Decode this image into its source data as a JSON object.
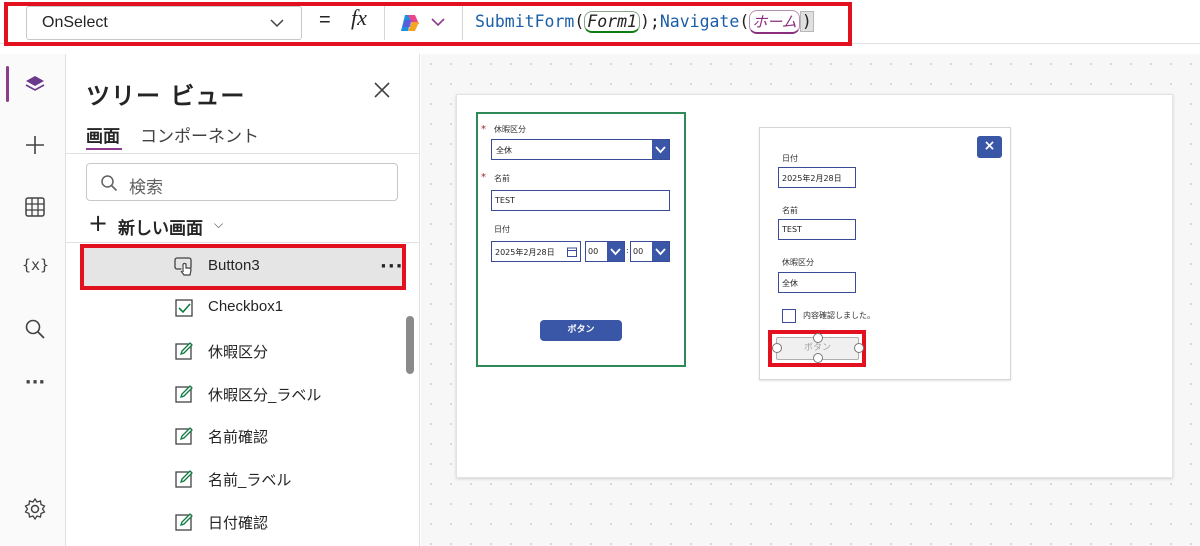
{
  "formula_bar": {
    "property": "OnSelect",
    "equals": "=",
    "fx": "fx",
    "formula": {
      "fn1": "SubmitForm",
      "open1": "(",
      "arg1": "Form1",
      "close1": ")",
      "sep": ";",
      "fn2": "Navigate",
      "open2": "(",
      "arg2": "ホーム",
      "close2": ")"
    }
  },
  "rail": {
    "icons": [
      "layers-icon",
      "plus-icon",
      "data-table-icon",
      "variables-icon",
      "search-icon",
      "more-icon",
      "settings-icon"
    ],
    "variables_label": "{x}",
    "more_label": "···"
  },
  "tree": {
    "title": "ツリー ビュー",
    "tabs": [
      {
        "label": "画面"
      },
      {
        "label": "コンポーネント"
      }
    ],
    "search_placeholder": "検索",
    "new_screen_label": "新しい画面",
    "items": [
      {
        "label": "Button3",
        "icon": "button-icon"
      },
      {
        "label": "Checkbox1",
        "icon": "checkbox-icon"
      },
      {
        "label": "休暇区分",
        "icon": "edit-icon"
      },
      {
        "label": "休暇区分_ラベル",
        "icon": "edit-icon"
      },
      {
        "label": "名前確認",
        "icon": "edit-icon"
      },
      {
        "label": "名前_ラベル",
        "icon": "edit-icon"
      },
      {
        "label": "日付確認",
        "icon": "edit-icon"
      }
    ],
    "more_label": "···"
  },
  "form_card": {
    "leave_type_label": "休暇区分",
    "leave_type_value": "全休",
    "name_label": "名前",
    "name_value": "TEST",
    "date_label": "日付",
    "date_value": "2025年2月28日",
    "hour_value": "00",
    "minute_value": "00",
    "time_sep": ":",
    "required_mark": "*",
    "button_label": "ボタン"
  },
  "detail_card": {
    "date_label": "日付",
    "date_value": "2025年2月28日",
    "name_label": "名前",
    "name_value": "TEST",
    "leave_type_label": "休暇区分",
    "leave_type_value": "全休",
    "checkbox_label": "内容確認しました。",
    "button_label": "ボタン",
    "close_label": "×"
  },
  "colors": {
    "highlight": "#e3101f",
    "accent_purple": "#8c3c8a",
    "control_blue": "#3a57a7",
    "form_border_green": "#2e8b57"
  }
}
